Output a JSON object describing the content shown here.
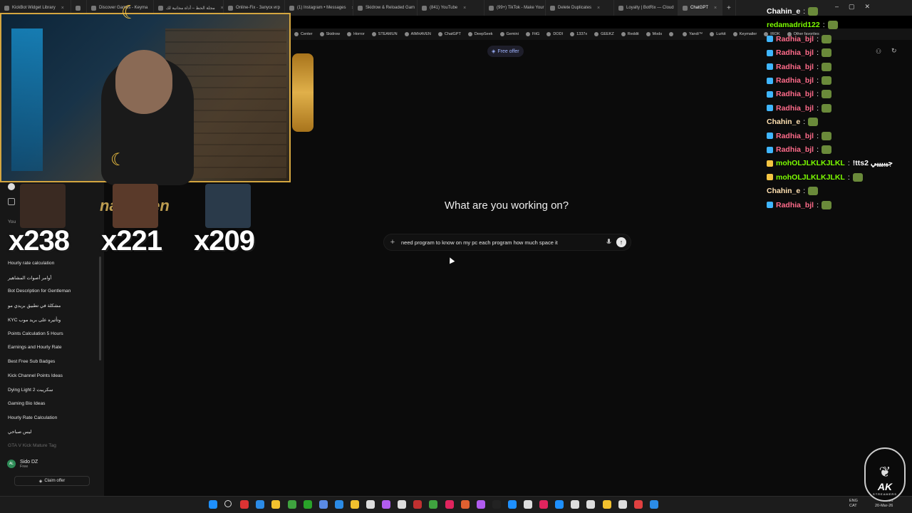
{
  "browser": {
    "tabs": [
      {
        "label": "KickBot Widget Library",
        "active": false
      },
      {
        "label": "",
        "active": false
      },
      {
        "label": "Discover Games - Keyma",
        "active": false
      },
      {
        "label": "مجلة الحظ – أداة مجانية لك",
        "active": false
      },
      {
        "label": "Online-Fix - Запуск игр",
        "active": false
      },
      {
        "label": "(1) Instagram • Messages",
        "active": false
      },
      {
        "label": "Skidrow & Reloaded Gam",
        "active": false
      },
      {
        "label": "(841) YouTube",
        "active": false
      },
      {
        "label": "(99+) TikTok - Make Your",
        "active": false
      },
      {
        "label": "Delete Duplicates",
        "active": false
      },
      {
        "label": "Loyalty | BotRix — Cloud",
        "active": false
      },
      {
        "label": "ChatGPT",
        "active": true
      }
    ],
    "bookmarks": [
      "Center",
      "Skidrow",
      "Horror",
      "STEAMUN",
      "AIMHAVEN",
      "ChatGPT",
      "DeepSeek",
      "Gemini",
      "FitG",
      "DODI",
      "1337x",
      "GEEKZ",
      "Reddit",
      "Mods",
      "",
      "Yandi™",
      "Lurkit",
      "Keymailer",
      "IROK",
      "Other favorites"
    ]
  },
  "chatgpt": {
    "free_offer": "Free offer",
    "headline": "What are you working on?",
    "composer_value": "need program to know on my pc each program how much space it",
    "sidebar_header": "You",
    "sidebar_items": [
      "Hourly rate calculation",
      "أوامر أصوات المشاهير",
      "Bot Description for Gentleman",
      "مشكلة في تطبيق بريدي مو",
      "KYC وتأثيره على بريد موب",
      "Points Calculation 5 Hours",
      "Earnings and Hourly Rate",
      "Best Free Sub Badges",
      "Kick Channel Points Ideas",
      "Dying Light 2 سكريبت",
      "Gaming Bio Ideas",
      "Hourly Rate Calculation",
      "ليس صباحي",
      "GTA V Kick Mature Tag"
    ],
    "profile": {
      "initials": "AL",
      "name": "Sido DZ",
      "plan": "Free"
    },
    "claim_offer": "Claim offer"
  },
  "stream_overlay": {
    "banner": "nadareen",
    "leaderboard": [
      {
        "count": "x238",
        "color": "#3a2a22"
      },
      {
        "count": "x221",
        "color": "#5a3a2a"
      },
      {
        "count": "x209",
        "color": "#2a3a4a"
      }
    ],
    "chat": [
      {
        "user": "Chahin_e",
        "color": "#ffffff",
        "msg": "",
        "badge": "",
        "emote": true
      },
      {
        "user": "redamadrid122",
        "color": "#7cfc00",
        "msg": "",
        "badge": "",
        "emote": true
      },
      {
        "user": "Radhia_bjl",
        "color": "#ff6b8a",
        "msg": "",
        "badge": "#3fb6ff",
        "emote": true
      },
      {
        "user": "Radhia_bjl",
        "color": "#ff6b8a",
        "msg": "",
        "badge": "#3fb6ff",
        "emote": true
      },
      {
        "user": "Radhia_bjl",
        "color": "#ff6b8a",
        "msg": "",
        "badge": "#3fb6ff",
        "emote": true
      },
      {
        "user": "Radhia_bjl",
        "color": "#ff6b8a",
        "msg": "",
        "badge": "#3fb6ff",
        "emote": true
      },
      {
        "user": "Radhia_bjl",
        "color": "#ff6b8a",
        "msg": "",
        "badge": "#3fb6ff",
        "emote": true
      },
      {
        "user": "Radhia_bjl",
        "color": "#ff6b8a",
        "msg": "",
        "badge": "#3fb6ff",
        "emote": true
      },
      {
        "user": "Chahin_e",
        "color": "#ffe0b0",
        "msg": "",
        "badge": "",
        "emote": true
      },
      {
        "user": "Radhia_bjl",
        "color": "#ff6b8a",
        "msg": "",
        "badge": "#3fb6ff",
        "emote": true
      },
      {
        "user": "Radhia_bjl",
        "color": "#ff6b8a",
        "msg": "",
        "badge": "#3fb6ff",
        "emote": true
      },
      {
        "user": "mohOLJLKLKJLKL",
        "color": "#7cfc00",
        "msg": "!tts2 جيبيييي",
        "badge": "#f5c542",
        "emote": false
      },
      {
        "user": "mohOLJLKLKJLKL",
        "color": "#7cfc00",
        "msg": "",
        "badge": "#f5c542",
        "emote": true
      },
      {
        "user": "Chahin_e",
        "color": "#ffe0b0",
        "msg": "",
        "badge": "",
        "emote": true
      },
      {
        "user": "Radhia_bjl",
        "color": "#ff6b8a",
        "msg": "",
        "badge": "#3fb6ff",
        "emote": true
      }
    ]
  },
  "taskbar": {
    "tray": [
      "ENG",
      "CAT"
    ],
    "time": "20:06",
    "date": "20-Mar-26"
  },
  "logo": {
    "title": "AK",
    "subtitle": "STREAMERS"
  }
}
